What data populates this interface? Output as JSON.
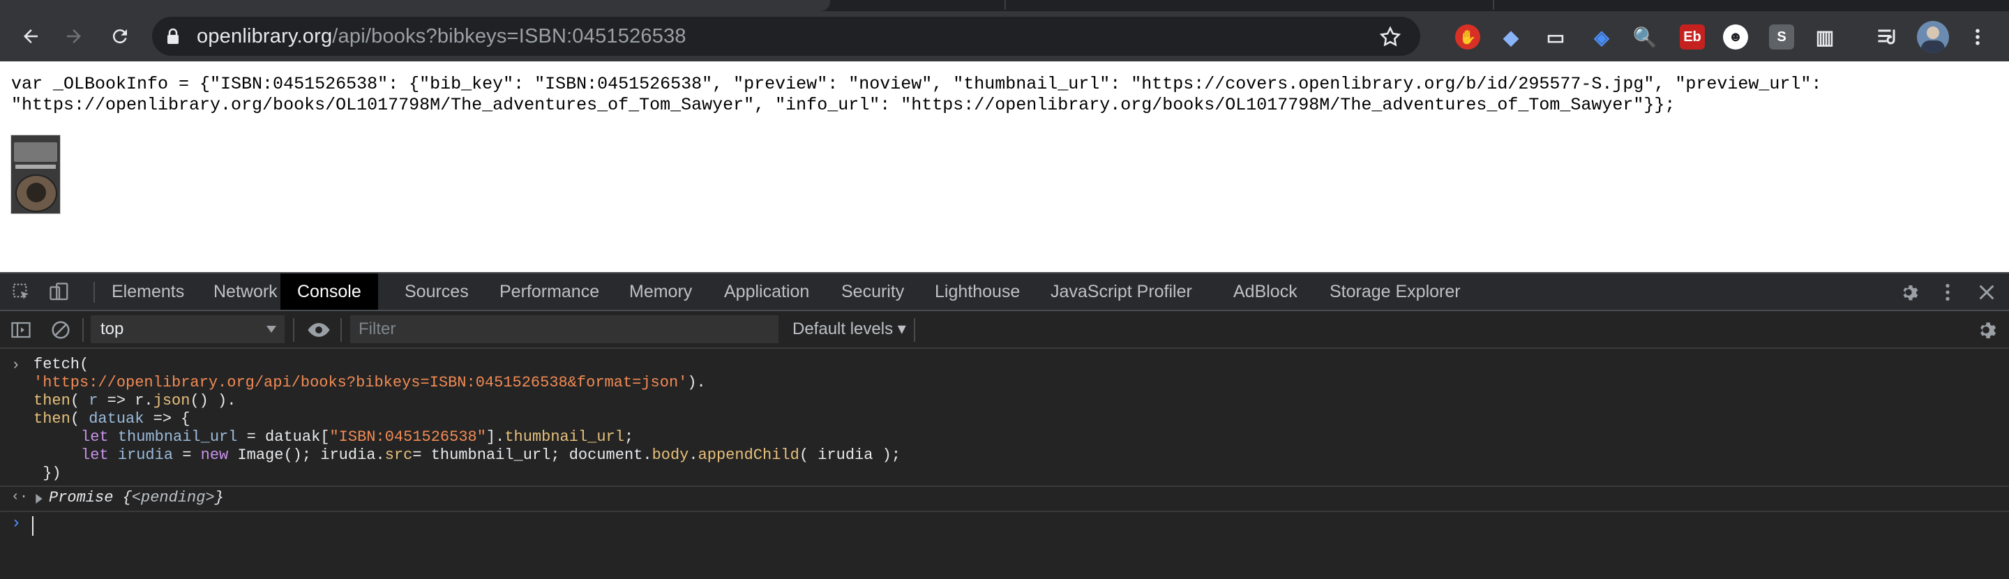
{
  "browser": {
    "url_domain": "openlibrary.org",
    "url_path": "/api/books?bibkeys=ISBN:0451526538",
    "extensions": [
      {
        "name": "adblock-icon",
        "color": "#d93025",
        "glyph": "✋"
      },
      {
        "name": "diamond-icon",
        "color": "#35363a",
        "glyph": "◆"
      },
      {
        "name": "document-icon",
        "color": "#35363a",
        "glyph": "▭"
      },
      {
        "name": "cube-icon",
        "color": "#35363a",
        "glyph": "◈"
      },
      {
        "name": "magnifier-icon",
        "color": "#35363a",
        "glyph": "🔍"
      },
      {
        "name": "eb-icon",
        "color": "#c5221f",
        "glyph": "Eb"
      },
      {
        "name": "ghost-icon",
        "color": "#ffffff",
        "glyph": "☻"
      },
      {
        "name": "s-icon",
        "color": "#5f6368",
        "glyph": "S"
      },
      {
        "name": "film-icon",
        "color": "#35363a",
        "glyph": "▥"
      }
    ]
  },
  "page": {
    "raw_line1": "var _OLBookInfo = {\"ISBN:0451526538\": {\"bib_key\": \"ISBN:0451526538\", \"preview\": \"noview\", \"thumbnail_url\": \"https://covers.openlibrary.org/b/id/295577-S.jpg\", \"preview_url\":",
    "raw_line2": "\"https://openlibrary.org/books/OL1017798M/The_adventures_of_Tom_Sawyer\", \"info_url\": \"https://openlibrary.org/books/OL1017798M/The_adventures_of_Tom_Sawyer\"}};"
  },
  "devtools": {
    "tabs": [
      "Elements",
      "Network",
      "Console",
      "Sources",
      "Performance",
      "Memory",
      "Application",
      "Security",
      "Lighthouse",
      "JavaScript Profiler",
      "AdBlock",
      "Storage Explorer"
    ],
    "active_tab": "Console",
    "context": "top",
    "filter_placeholder": "Filter",
    "levels": "Default levels ▾",
    "code": {
      "l1": "fetch(",
      "l2_str": "'https://openlibrary.org/api/books?bibkeys=ISBN:0451526538&format=json'",
      "l2_end": ").",
      "l3_then": "then",
      "l3_a": "( ",
      "l3_r": "r",
      "l3_b": " => r.",
      "l3_json": "json",
      "l3_c": "() ).",
      "l4_then": "then",
      "l4_a": "( ",
      "l4_var": "datuak",
      "l4_b": " => {",
      "l5_let": "let",
      "l5_var": "thumbnail_url",
      "l5_a": " = datuak[",
      "l5_str": "\"ISBN:0451526538\"",
      "l5_b": "].",
      "l5_prop": "thumbnail_url",
      "l5_c": ";",
      "l6_let": "let",
      "l6_var": "irudia",
      "l6_a": " = ",
      "l6_new": "new",
      "l6_b": " Image(); irudia.",
      "l6_src": "src",
      "l6_c": "= thumbnail_url; document.",
      "l6_body": "body",
      "l6_d": ".",
      "l6_append": "appendChild",
      "l6_e": "( irudia );",
      "l7": " })",
      "promise": "Promise {",
      "pending": "<pending>",
      "promise_end": "}"
    }
  }
}
